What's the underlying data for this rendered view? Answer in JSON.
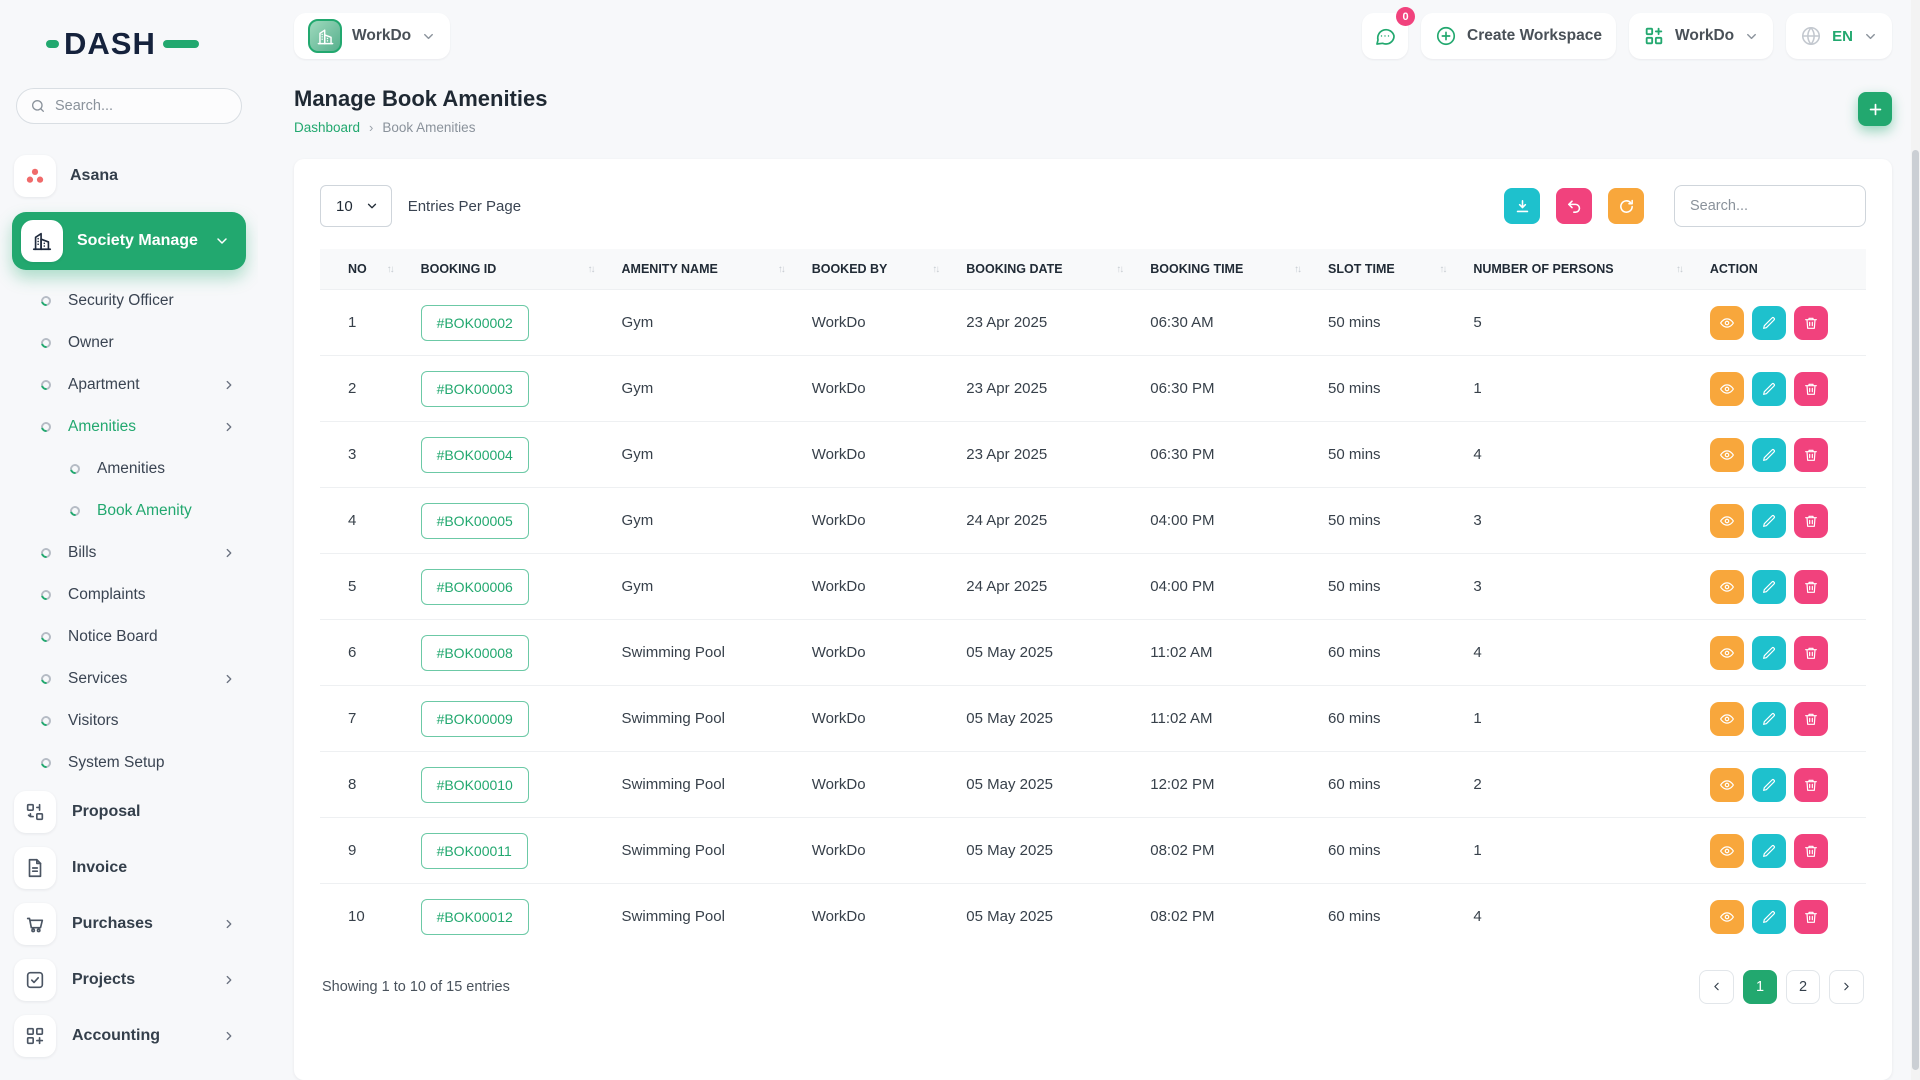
{
  "colors": {
    "primary": "#22a86f",
    "cyan": "#1ec1cd",
    "pink": "#f1427d",
    "orange": "#f8a73c",
    "asana_red": "#f06a6a"
  },
  "sidebar": {
    "logo_text": "DASH",
    "search_placeholder": "Search...",
    "workspaces": [
      {
        "label": "Asana",
        "icon": "asana-icon",
        "active": false,
        "chevron": false
      },
      {
        "label": "Society Manage",
        "icon": "building-icon",
        "active": true,
        "chevron": true
      }
    ],
    "menu": [
      {
        "label": "Security Officer",
        "indent": 0,
        "active": false,
        "chevron": false
      },
      {
        "label": "Owner",
        "indent": 0,
        "active": false,
        "chevron": false
      },
      {
        "label": "Apartment",
        "indent": 0,
        "active": false,
        "chevron": true
      },
      {
        "label": "Amenities",
        "indent": 0,
        "active": true,
        "chevron": true
      },
      {
        "label": "Amenities",
        "indent": 1,
        "active": false,
        "chevron": false
      },
      {
        "label": "Book Amenity",
        "indent": 1,
        "active": true,
        "chevron": false
      },
      {
        "label": "Bills",
        "indent": 0,
        "active": false,
        "chevron": true
      },
      {
        "label": "Complaints",
        "indent": 0,
        "active": false,
        "chevron": false
      },
      {
        "label": "Notice Board",
        "indent": 0,
        "active": false,
        "chevron": false
      },
      {
        "label": "Services",
        "indent": 0,
        "active": false,
        "chevron": true
      },
      {
        "label": "Visitors",
        "indent": 0,
        "active": false,
        "chevron": false
      },
      {
        "label": "System Setup",
        "indent": 0,
        "active": false,
        "chevron": false
      }
    ],
    "modules": [
      {
        "label": "Proposal",
        "icon": "proposal-icon",
        "chevron": false
      },
      {
        "label": "Invoice",
        "icon": "invoice-icon",
        "chevron": false
      },
      {
        "label": "Purchases",
        "icon": "cart-icon",
        "chevron": true
      },
      {
        "label": "Projects",
        "icon": "check-square-icon",
        "chevron": true
      },
      {
        "label": "Accounting",
        "icon": "blocks-icon",
        "chevron": true
      }
    ]
  },
  "topbar": {
    "workspace_pill": "WorkDo",
    "chat_badge": "0",
    "create_workspace_label": "Create Workspace",
    "workdo_menu_label": "WorkDo",
    "language": "EN"
  },
  "page": {
    "title": "Manage Book Amenities",
    "breadcrumb": [
      "Dashboard",
      "Book Amenities"
    ]
  },
  "controls": {
    "entries_value": "10",
    "entries_label": "Entries Per Page",
    "search_placeholder": "Search..."
  },
  "table": {
    "columns": [
      "NO",
      "BOOKING ID",
      "AMENITY NAME",
      "BOOKED BY",
      "BOOKING DATE",
      "BOOKING TIME",
      "SLOT TIME",
      "NUMBER OF PERSONS",
      "ACTION"
    ],
    "rows": [
      {
        "no": "1",
        "booking_id": "#BOK00002",
        "amenity": "Gym",
        "booked_by": "WorkDo",
        "date": "23 Apr 2025",
        "time": "06:30 AM",
        "slot": "50 mins",
        "persons": "5"
      },
      {
        "no": "2",
        "booking_id": "#BOK00003",
        "amenity": "Gym",
        "booked_by": "WorkDo",
        "date": "23 Apr 2025",
        "time": "06:30 PM",
        "slot": "50 mins",
        "persons": "1"
      },
      {
        "no": "3",
        "booking_id": "#BOK00004",
        "amenity": "Gym",
        "booked_by": "WorkDo",
        "date": "23 Apr 2025",
        "time": "06:30 PM",
        "slot": "50 mins",
        "persons": "4"
      },
      {
        "no": "4",
        "booking_id": "#BOK00005",
        "amenity": "Gym",
        "booked_by": "WorkDo",
        "date": "24 Apr 2025",
        "time": "04:00 PM",
        "slot": "50 mins",
        "persons": "3"
      },
      {
        "no": "5",
        "booking_id": "#BOK00006",
        "amenity": "Gym",
        "booked_by": "WorkDo",
        "date": "24 Apr 2025",
        "time": "04:00 PM",
        "slot": "50 mins",
        "persons": "3"
      },
      {
        "no": "6",
        "booking_id": "#BOK00008",
        "amenity": "Swimming Pool",
        "booked_by": "WorkDo",
        "date": "05 May 2025",
        "time": "11:02 AM",
        "slot": "60 mins",
        "persons": "4"
      },
      {
        "no": "7",
        "booking_id": "#BOK00009",
        "amenity": "Swimming Pool",
        "booked_by": "WorkDo",
        "date": "05 May 2025",
        "time": "11:02 AM",
        "slot": "60 mins",
        "persons": "1"
      },
      {
        "no": "8",
        "booking_id": "#BOK00010",
        "amenity": "Swimming Pool",
        "booked_by": "WorkDo",
        "date": "05 May 2025",
        "time": "12:02 PM",
        "slot": "60 mins",
        "persons": "2"
      },
      {
        "no": "9",
        "booking_id": "#BOK00011",
        "amenity": "Swimming Pool",
        "booked_by": "WorkDo",
        "date": "05 May 2025",
        "time": "08:02 PM",
        "slot": "60 mins",
        "persons": "1"
      },
      {
        "no": "10",
        "booking_id": "#BOK00012",
        "amenity": "Swimming Pool",
        "booked_by": "WorkDo",
        "date": "05 May 2025",
        "time": "08:02 PM",
        "slot": "60 mins",
        "persons": "4"
      }
    ]
  },
  "footer": {
    "showing": "Showing 1 to 10 of 15 entries",
    "pages": [
      "1",
      "2"
    ],
    "active_page": "1"
  }
}
